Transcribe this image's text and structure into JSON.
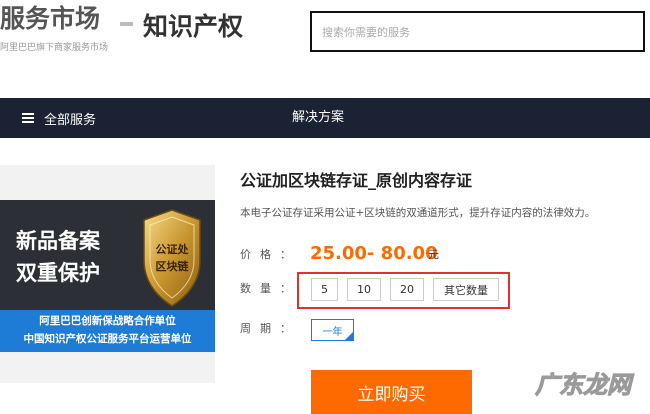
{
  "header": {
    "logo_main": "服务市场",
    "logo_sub": "阿里巴巴旗下商家服务市场",
    "logo_section": "知识产权",
    "search_placeholder": "搜索你需要的服务"
  },
  "nav": {
    "all_services": "全部服务",
    "solutions": "解决方案"
  },
  "product_image": {
    "line1": "新品备案",
    "line2": "双重保护",
    "badge_line1": "公证处",
    "badge_line2": "区块链",
    "strip_line1": "阿里巴巴创新保战略合作单位",
    "strip_line2": "中国知识产权公证服务平台运营单位"
  },
  "product": {
    "title": "公证加区块链存证_原创内容存证",
    "description": "本电子公证存证采用公证+区块链的双通道形式，提升存证内容的法律效力。",
    "price_label": "价格：",
    "price": "25.00- 80.00",
    "price_unit": "元",
    "quantity_label": "数量：",
    "quantity_options": [
      "5",
      "10",
      "20",
      "其它数量"
    ],
    "period_label": "周期：",
    "period_selected": "一年",
    "buy_label": "立即购买"
  },
  "watermark": {
    "text": "广东龙网"
  },
  "colors": {
    "accent_orange": "#ff6a00",
    "nav_bg": "#1a2233",
    "selected_blue": "#1e7cd6",
    "highlight_red": "#e03030"
  }
}
